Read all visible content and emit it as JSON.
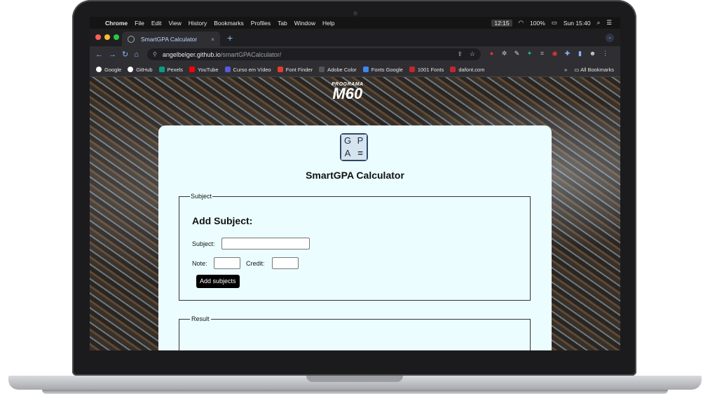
{
  "menubar": {
    "apple": "",
    "items": [
      "Chrome",
      "File",
      "Edit",
      "View",
      "History",
      "Bookmarks",
      "Profiles",
      "Tab",
      "Window",
      "Help"
    ],
    "time_box": "12:15",
    "battery": "100%",
    "datetime": "Sun 15:40"
  },
  "tab": {
    "title": "SmartGPA Calculator",
    "close": "×",
    "new_tab": "+"
  },
  "omnibox": {
    "domain": "angelbelger.github.io",
    "path": "/smartGPACalculator/"
  },
  "bookmarks": {
    "items": [
      {
        "label": "Google",
        "color": "#ffffff"
      },
      {
        "label": "GitHub",
        "color": "#ffffff"
      },
      {
        "label": "Pexels",
        "color": "#05a081"
      },
      {
        "label": "YouTube",
        "color": "#ff0000"
      },
      {
        "label": "Curso em Vídeo",
        "color": "#5a5adc"
      },
      {
        "label": "Font Finder",
        "color": "#e43d2f"
      },
      {
        "label": "Adobe Color",
        "color": "#333333"
      },
      {
        "label": "Fonts Google",
        "color": "#4285f4"
      },
      {
        "label": "1001 Fonts",
        "color": "#c2262d"
      },
      {
        "label": "dafont.com",
        "color": "#c2262d"
      }
    ],
    "more": "»",
    "all": "All Bookmarks"
  },
  "page": {
    "logo_small": "PROGRAMA",
    "logo_big": "M60",
    "gpa_letters": [
      "G",
      "P",
      "A",
      "="
    ],
    "title": "SmartGPA Calculator",
    "subject_legend": "Subject",
    "add_heading": "Add Subject:",
    "subject_label": "Subject:",
    "note_label": "Note:",
    "credit_label": "Credit:",
    "add_button": "Add subjects",
    "result_legend": "Result"
  },
  "dock": {
    "apps": [
      {
        "name": "finder",
        "color": "#3d8fe0"
      },
      {
        "name": "siri",
        "color": "#7a4fd6"
      },
      {
        "name": "launchpad",
        "color": "#8a8a90"
      },
      {
        "name": "chrome",
        "color": "#e9e9e9"
      },
      {
        "name": "safari",
        "color": "#2f7cf6"
      },
      {
        "name": "firefox",
        "color": "#ff6a1f"
      },
      {
        "name": "github-desktop",
        "color": "#8e44c9"
      },
      {
        "name": "photos",
        "color": "#f3f3f3"
      },
      {
        "name": "music",
        "color": "#fb3a5b"
      },
      {
        "name": "outlook",
        "color": "#0f6cbd"
      },
      {
        "name": "word",
        "color": "#2b5fb4"
      },
      {
        "name": "app-store",
        "color": "#1a8cff",
        "badge": "3"
      },
      {
        "name": "system-preferences",
        "color": "#6d6d72",
        "badge": "1"
      },
      {
        "name": "settings-gear",
        "color": "#a6a6ad"
      },
      {
        "name": "telegram",
        "color": "#2aa5df"
      },
      {
        "name": "xcode-airplane",
        "color": "#4a9ae0"
      },
      {
        "name": "sublime-grid",
        "color": "#c9c9c9"
      },
      {
        "name": "facetime",
        "color": "#2fc84a",
        "badge": "5"
      },
      {
        "name": "window-previews",
        "color": "#d0d0d0"
      },
      {
        "name": "trash",
        "color": "#9a9aa0"
      }
    ]
  }
}
